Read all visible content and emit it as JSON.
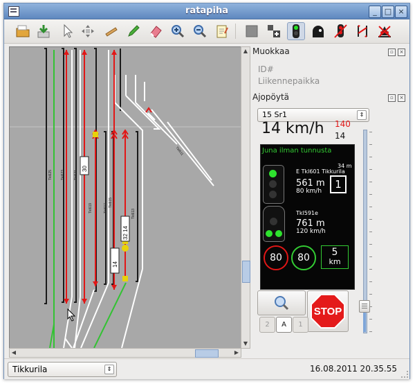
{
  "window": {
    "title": "ratapiha"
  },
  "toolbar": {
    "icons": [
      "open-folder-icon",
      "save-download-icon",
      "select-pointer-icon",
      "move-arrows-icon",
      "ruler-icon",
      "pencil-icon",
      "eraser-icon",
      "zoom-in-icon",
      "zoom-out-icon",
      "notepad-icon",
      "grey-block-icon",
      "route-add-icon",
      "signal-green-icon",
      "tunnel-icon",
      "signal-red-icon",
      "switch-arrows-icon",
      "train-red-icon"
    ],
    "active": "signal-green-icon"
  },
  "map": {
    "track_labels": [
      "Tkl625",
      "Tkl623",
      "Tkl621",
      "Tkl619",
      "Tkl617",
      "Tkl615",
      "Tkl613",
      "Tkl611",
      "Tkl609",
      "Tkl607"
    ],
    "train_labels": [
      "30",
      "32 14",
      "14"
    ]
  },
  "muokkaa": {
    "title": "Muokkaa",
    "id_label": "ID#",
    "place_label": "Liikennepaikka"
  },
  "ajopoyta": {
    "title": "Ajopöytä",
    "train_select": "15 Sr1",
    "current_speed": "14 km/h",
    "target_speed": "140",
    "actual_speed": "14",
    "cab": {
      "status_text": "Juna ilman tunnusta",
      "next_signal_distance_label": "34 m",
      "signal1_name": "E Tkl601 Tikkurila",
      "signal1_distance": "561 m",
      "signal1_speed": "80 km/h",
      "signal1_number": "1",
      "signal2_name": "Tkl591e",
      "signal2_distance": "761 m",
      "signal2_speed": "120 km/h",
      "limit_red": "80",
      "limit_green": "80",
      "distance_box_value": "5",
      "distance_box_unit": "km"
    },
    "buttons": {
      "stop_label": "STOP",
      "b2": "2",
      "bA": "A",
      "b1": "1"
    },
    "slider_level": 0.11
  },
  "status": {
    "station": "Tikkurila",
    "datetime": "16.08.2011 20.35.55"
  }
}
